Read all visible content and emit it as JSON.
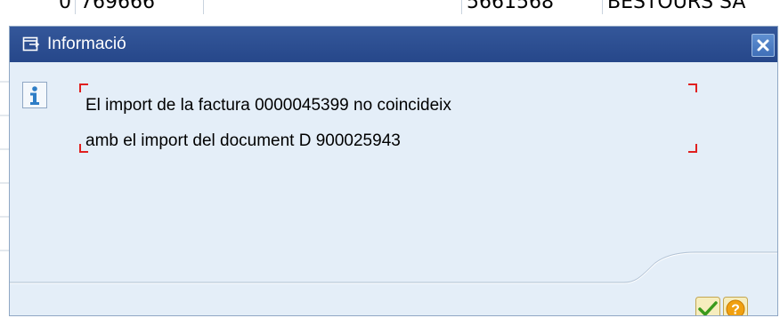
{
  "background_table": {
    "cells": [
      "0",
      "769666",
      "5661568",
      "BESTOURS SA"
    ]
  },
  "dialog": {
    "title": "Informació",
    "message": {
      "line1": "El import de la factura 0000045399 no coincideix",
      "line2": "amb el import del document D 900025943"
    }
  },
  "icons": {
    "title_icon": "dialog-window-icon",
    "close": "close-icon",
    "info": "info-icon",
    "ok": "checkmark-icon",
    "help": "help-question-icon"
  },
  "colors": {
    "titlebar": "#2c4f93",
    "content_bg": "#e4eef8",
    "bracket": "#e02020",
    "info_icon": "#2e7dc6",
    "ok_check": "#3a9a1c",
    "help_circle": "#f0a010"
  }
}
